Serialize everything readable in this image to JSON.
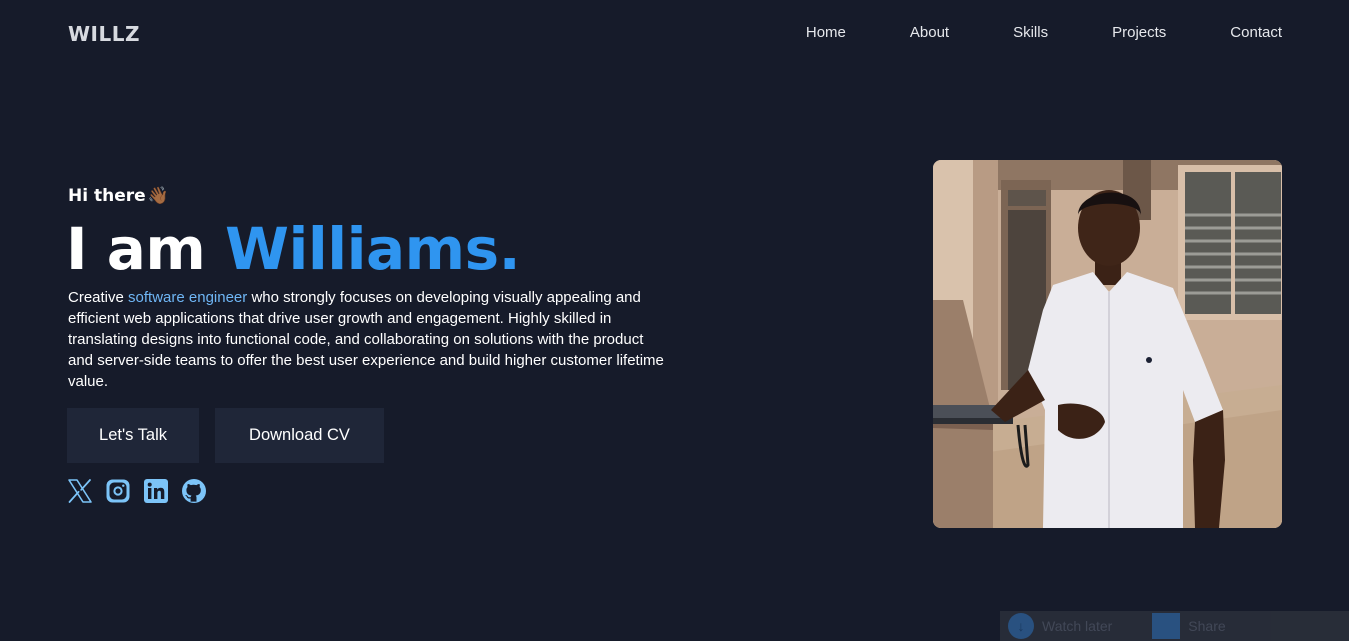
{
  "header": {
    "logo": "WILLZ",
    "nav": [
      "Home",
      "About",
      "Skills",
      "Projects",
      "Contact"
    ]
  },
  "hero": {
    "greeting": "Hi there",
    "wave_emoji": "👋🏾",
    "headline_prefix": "I am ",
    "headline_name": "Williams.",
    "bio_before": "Creative ",
    "bio_highlight": "software engineer",
    "bio_after": " who strongly focuses on developing visually appealing and efficient web applications that drive user growth and engagement. Highly skilled in translating designs into functional code, and collaborating on solutions with the product and server-side teams to offer the best user experience and build higher customer lifetime value.",
    "buttons": {
      "talk": "Let's Talk",
      "cv": "Download CV"
    },
    "socials": [
      "x-icon",
      "instagram-icon",
      "linkedin-icon",
      "github-icon"
    ]
  },
  "colors": {
    "background": "#161b2a",
    "accent": "#2f95f0",
    "highlight": "#6fb6f5",
    "button_bg": "#1f2638",
    "social_icon": "#7cc4f8"
  },
  "toast": {
    "download_label": "Watch later",
    "second_label": "Share"
  }
}
